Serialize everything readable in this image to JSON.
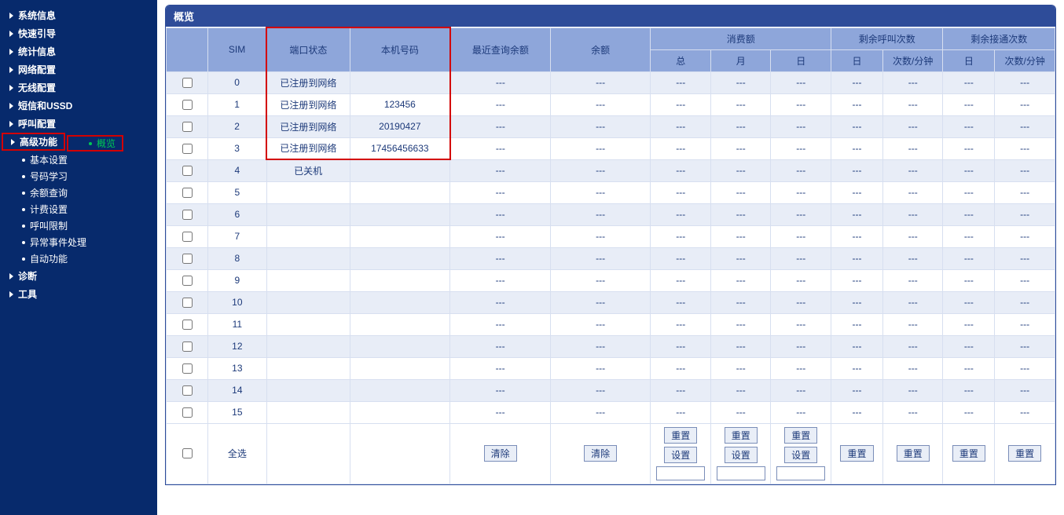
{
  "sidebar": {
    "items": [
      {
        "label": "系统信息",
        "type": "main"
      },
      {
        "label": "快速引导",
        "type": "main"
      },
      {
        "label": "统计信息",
        "type": "main"
      },
      {
        "label": "网络配置",
        "type": "main"
      },
      {
        "label": "无线配置",
        "type": "main"
      },
      {
        "label": "短信和USSD",
        "type": "main"
      },
      {
        "label": "呼叫配置",
        "type": "main"
      },
      {
        "label": "高级功能",
        "type": "main",
        "highlight": true
      },
      {
        "label": "概览",
        "type": "sub",
        "active": true
      },
      {
        "label": "基本设置",
        "type": "sub"
      },
      {
        "label": "号码学习",
        "type": "sub"
      },
      {
        "label": "余额查询",
        "type": "sub"
      },
      {
        "label": "计费设置",
        "type": "sub"
      },
      {
        "label": "呼叫限制",
        "type": "sub"
      },
      {
        "label": "异常事件处理",
        "type": "sub"
      },
      {
        "label": "自动功能",
        "type": "sub"
      },
      {
        "label": "诊断",
        "type": "main"
      },
      {
        "label": "工具",
        "type": "main"
      }
    ]
  },
  "panel": {
    "title": "概览"
  },
  "columns": {
    "sim": "SIM",
    "port_status": "端口状态",
    "local_number": "本机号码",
    "last_balance_query": "最近查询余额",
    "balance": "余额",
    "consumption": "消费额",
    "remaining_calls": "剩余呼叫次数",
    "remaining_connects": "剩余接通次数",
    "total": "总",
    "month": "月",
    "day": "日",
    "times_per_minute": "次数/分钟"
  },
  "rows": [
    {
      "sim": "0",
      "port_status": "已注册到网络",
      "local_number": ""
    },
    {
      "sim": "1",
      "port_status": "已注册到网络",
      "local_number": "123456"
    },
    {
      "sim": "2",
      "port_status": "已注册到网络",
      "local_number": "20190427"
    },
    {
      "sim": "3",
      "port_status": "已注册到网络",
      "local_number": "17456456633"
    },
    {
      "sim": "4",
      "port_status": "已关机",
      "local_number": ""
    },
    {
      "sim": "5",
      "port_status": "",
      "local_number": ""
    },
    {
      "sim": "6",
      "port_status": "",
      "local_number": ""
    },
    {
      "sim": "7",
      "port_status": "",
      "local_number": ""
    },
    {
      "sim": "8",
      "port_status": "",
      "local_number": ""
    },
    {
      "sim": "9",
      "port_status": "",
      "local_number": ""
    },
    {
      "sim": "10",
      "port_status": "",
      "local_number": ""
    },
    {
      "sim": "11",
      "port_status": "",
      "local_number": ""
    },
    {
      "sim": "12",
      "port_status": "",
      "local_number": ""
    },
    {
      "sim": "13",
      "port_status": "",
      "local_number": ""
    },
    {
      "sim": "14",
      "port_status": "",
      "local_number": ""
    },
    {
      "sim": "15",
      "port_status": "",
      "local_number": ""
    }
  ],
  "placeholder": "---",
  "footer": {
    "select_all": "全选",
    "clear": "清除",
    "reset": "重置",
    "set": "设置"
  }
}
